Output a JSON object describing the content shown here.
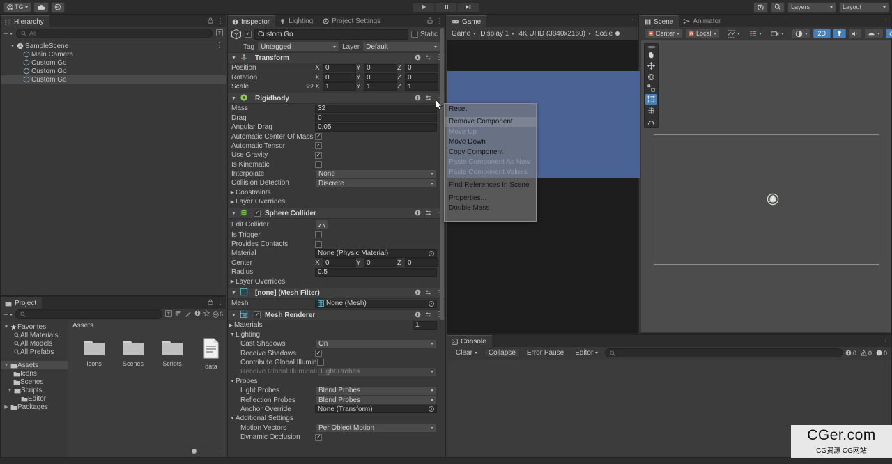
{
  "toolbar": {
    "account_label": "TG",
    "left_icons": [
      "account-icon",
      "cloud-icon",
      "settings-icon"
    ],
    "play_buttons": [
      "play-icon",
      "pause-icon",
      "step-icon"
    ],
    "right": {
      "undo_history_icon": "undo-history-icon",
      "search_icon": "search-icon",
      "layers_label": "Layers",
      "layout_label": "Layout"
    }
  },
  "hierarchy": {
    "tab": "Hierarchy",
    "lock_icon": "lock-icon",
    "menu_icon": "kebab-icon",
    "add_label": "+",
    "search_placeholder": "All",
    "tree": [
      {
        "label": "SampleScene",
        "depth": 0,
        "icon": "scene-icon",
        "expanded": true,
        "selected": false
      },
      {
        "label": "Main Camera",
        "depth": 1,
        "icon": "gameobject-icon",
        "expanded": false,
        "selected": false
      },
      {
        "label": "Custom Go",
        "depth": 1,
        "icon": "gameobject-icon",
        "expanded": false,
        "selected": false
      },
      {
        "label": "Custom Go",
        "depth": 1,
        "icon": "gameobject-icon",
        "expanded": false,
        "selected": false
      },
      {
        "label": "Custom Go",
        "depth": 1,
        "icon": "gameobject-icon",
        "expanded": false,
        "selected": true
      }
    ]
  },
  "project": {
    "tab": "Project",
    "search_placeholder": "",
    "favorites_label": "Favorites",
    "favorites": [
      "All Materials",
      "All Models",
      "All Prefabs"
    ],
    "folders": [
      {
        "label": "Assets",
        "depth": 0,
        "expanded": true,
        "selected": true
      },
      {
        "label": "Icons",
        "depth": 1,
        "expanded": false,
        "selected": false
      },
      {
        "label": "Scenes",
        "depth": 1,
        "expanded": false,
        "selected": false
      },
      {
        "label": "Scripts",
        "depth": 1,
        "expanded": true,
        "selected": false
      },
      {
        "label": "Editor",
        "depth": 2,
        "expanded": false,
        "selected": false
      },
      {
        "label": "Packages",
        "depth": 0,
        "expanded": false,
        "selected": false
      }
    ],
    "breadcrumb": "Assets",
    "items": [
      {
        "label": "Icons",
        "type": "folder"
      },
      {
        "label": "Scenes",
        "type": "folder"
      },
      {
        "label": "Scripts",
        "type": "folder"
      },
      {
        "label": "data",
        "type": "file"
      }
    ],
    "count_badge": "6"
  },
  "inspector": {
    "tabs": [
      {
        "label": "Inspector",
        "icon": "info-icon",
        "active": true
      },
      {
        "label": "Lighting",
        "icon": "bulb-icon",
        "active": false
      },
      {
        "label": "Project Settings",
        "icon": "gear-icon",
        "active": false
      }
    ],
    "object": {
      "enabled": true,
      "name": "Custom Go",
      "static_label": "Static",
      "tag_label": "Tag",
      "tag_value": "Untagged",
      "layer_label": "Layer",
      "layer_value": "Default"
    },
    "components": [
      {
        "name": "Transform",
        "icon": "transform-icon",
        "has_checkbox": false,
        "rows": [
          {
            "label": "Position",
            "type": "vector3",
            "x": "0",
            "y": "0",
            "z": "0"
          },
          {
            "label": "Rotation",
            "type": "vector3",
            "x": "0",
            "y": "0",
            "z": "0"
          },
          {
            "label": "Scale",
            "type": "vector3",
            "x": "1",
            "y": "1",
            "z": "1",
            "link": true
          }
        ]
      },
      {
        "name": "Rigidbody",
        "icon": "rigidbody-icon",
        "has_checkbox": false,
        "rows": [
          {
            "label": "Mass",
            "type": "text",
            "value": "32"
          },
          {
            "label": "Drag",
            "type": "text",
            "value": "0"
          },
          {
            "label": "Angular Drag",
            "type": "text",
            "value": "0.05"
          },
          {
            "label": "Automatic Center Of Mass",
            "type": "check",
            "checked": true
          },
          {
            "label": "Automatic Tensor",
            "type": "check",
            "checked": true
          },
          {
            "label": "Use Gravity",
            "type": "check",
            "checked": true
          },
          {
            "label": "Is Kinematic",
            "type": "check",
            "checked": false
          },
          {
            "label": "Interpolate",
            "type": "dropdown",
            "value": "None"
          },
          {
            "label": "Collision Detection",
            "type": "dropdown",
            "value": "Discrete"
          },
          {
            "label": "Constraints",
            "type": "foldout"
          },
          {
            "label": "Layer Overrides",
            "type": "foldout"
          }
        ]
      },
      {
        "name": "Sphere Collider",
        "icon": "collider-icon",
        "has_checkbox": true,
        "checked": true,
        "rows": [
          {
            "label": "Edit Collider",
            "type": "button",
            "value": "edit-collider-icon"
          },
          {
            "label": "Is Trigger",
            "type": "check",
            "checked": false
          },
          {
            "label": "Provides Contacts",
            "type": "check",
            "checked": false
          },
          {
            "label": "Material",
            "type": "object",
            "value": "None (Physic Material)"
          },
          {
            "label": "Center",
            "type": "vector3",
            "x": "0",
            "y": "0",
            "z": "0"
          },
          {
            "label": "Radius",
            "type": "text",
            "value": "0.5"
          },
          {
            "label": "Layer Overrides",
            "type": "foldout"
          }
        ]
      },
      {
        "name": "[none] (Mesh Filter)",
        "icon": "meshfilter-icon",
        "has_checkbox": false,
        "rows": [
          {
            "label": "Mesh",
            "type": "object",
            "value": "None (Mesh)"
          }
        ]
      },
      {
        "name": "Mesh Renderer",
        "icon": "meshrenderer-icon",
        "has_checkbox": true,
        "checked": true,
        "rows": [
          {
            "label": "Materials",
            "type": "foldout-count",
            "value": "1"
          },
          {
            "label": "Lighting",
            "type": "group"
          },
          {
            "label": "Cast Shadows",
            "type": "dropdown",
            "value": "On",
            "indent": 1
          },
          {
            "label": "Receive Shadows",
            "type": "check",
            "checked": true,
            "indent": 1
          },
          {
            "label": "Contribute Global Illumination",
            "type": "check",
            "checked": false,
            "indent": 1
          },
          {
            "label": "Receive Global Illumination",
            "type": "dropdown",
            "value": "Light Probes",
            "indent": 1,
            "disabled": true
          },
          {
            "label": "Probes",
            "type": "group"
          },
          {
            "label": "Light Probes",
            "type": "dropdown",
            "value": "Blend Probes",
            "indent": 1
          },
          {
            "label": "Reflection Probes",
            "type": "dropdown",
            "value": "Blend Probes",
            "indent": 1
          },
          {
            "label": "Anchor Override",
            "type": "object",
            "value": "None (Transform)",
            "indent": 1
          },
          {
            "label": "Additional Settings",
            "type": "group"
          },
          {
            "label": "Motion Vectors",
            "type": "dropdown",
            "value": "Per Object Motion",
            "indent": 1
          },
          {
            "label": "Dynamic Occlusion",
            "type": "check",
            "checked": true,
            "indent": 1
          }
        ]
      }
    ]
  },
  "context_menu": {
    "items": [
      {
        "label": "Reset",
        "state": "normal"
      },
      {
        "label": "Remove Component",
        "state": "highlight"
      },
      {
        "label": "Move Up",
        "state": "disabled"
      },
      {
        "label": "Move Down",
        "state": "normal"
      },
      {
        "label": "Copy Component",
        "state": "normal"
      },
      {
        "label": "Paste Component As New",
        "state": "disabled"
      },
      {
        "label": "Paste Component Values",
        "state": "disabled"
      },
      {
        "label": "",
        "state": "separator"
      },
      {
        "label": "Find References In Scene",
        "state": "normal"
      },
      {
        "label": "",
        "state": "separator"
      },
      {
        "label": "Properties...",
        "state": "normal"
      },
      {
        "label": "Double Mass",
        "state": "normal"
      }
    ]
  },
  "game": {
    "tab": "Game",
    "mode": "Game",
    "display": "Display 1",
    "resolution": "4K UHD (3840x2160)",
    "scale_label": "Scale",
    "background_color": "#4a6394"
  },
  "scene": {
    "tabs": [
      {
        "label": "Scene",
        "icon": "scene-view-icon",
        "active": true
      },
      {
        "label": "Animator",
        "icon": "animator-icon",
        "active": false
      }
    ],
    "pivot_label": "Center",
    "space_label": "Local",
    "toggles_2d": "2D",
    "tools": [
      "hand-tool-icon",
      "move-tool-icon",
      "rotate-tool-icon",
      "scale-tool-icon",
      "rect-tool-icon",
      "transform-tool-icon",
      "custom-tool-icon"
    ],
    "active_tool_index": 4,
    "toolbar_icons": [
      "grid-icon",
      "snap-icon",
      "ruler-icon",
      "lighting-icon",
      "audio-icon",
      "fx-icon",
      "gizmos-icon"
    ]
  },
  "console": {
    "tab": "Console",
    "clear_label": "Clear",
    "collapse_label": "Collapse",
    "error_pause_label": "Error Pause",
    "editor_label": "Editor",
    "search_placeholder": "",
    "counts": {
      "log": "0",
      "warning": "0",
      "error": "0"
    }
  },
  "watermark": {
    "line1": "CGer.com",
    "line2": "CG资源 CG网站"
  }
}
